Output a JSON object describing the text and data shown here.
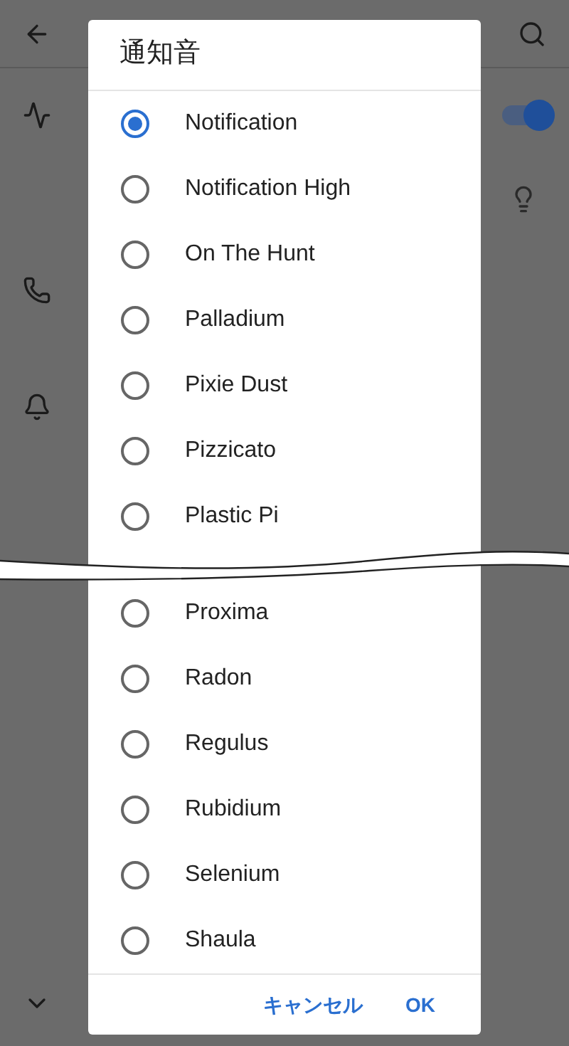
{
  "background": {
    "vibrate_toggle": {
      "on": true
    }
  },
  "dialog": {
    "title": "通知音",
    "options_top": [
      {
        "label": "Notification",
        "selected": true
      },
      {
        "label": "Notification High",
        "selected": false
      },
      {
        "label": "On The Hunt",
        "selected": false
      },
      {
        "label": "Palladium",
        "selected": false
      },
      {
        "label": "Pixie Dust",
        "selected": false
      },
      {
        "label": "Pizzicato",
        "selected": false
      },
      {
        "label": "Plastic Pi",
        "selected": false
      }
    ],
    "options_bottom": [
      {
        "label": "Proxima",
        "selected": false
      },
      {
        "label": "Radon",
        "selected": false
      },
      {
        "label": "Regulus",
        "selected": false
      },
      {
        "label": "Rubidium",
        "selected": false
      },
      {
        "label": "Selenium",
        "selected": false
      },
      {
        "label": "Shaula",
        "selected": false
      }
    ],
    "buttons": [
      "キャンセル",
      "OK"
    ]
  }
}
